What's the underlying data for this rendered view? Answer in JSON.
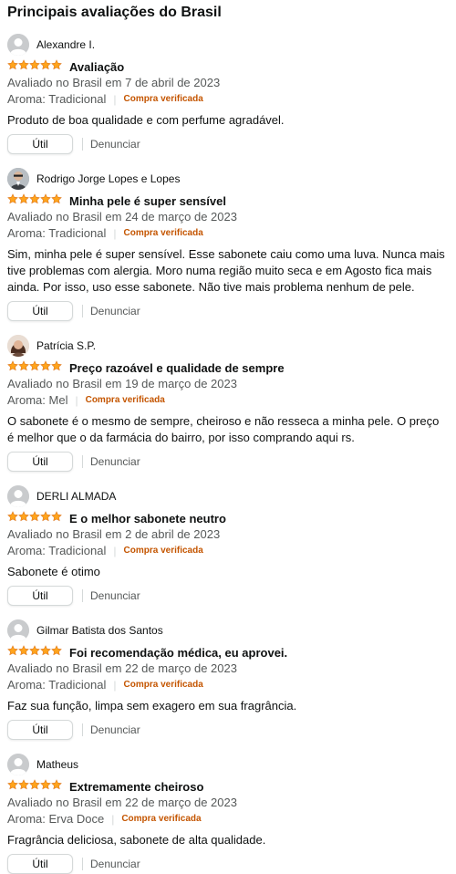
{
  "heading": "Principais avaliações do Brasil",
  "colors": {
    "star": "#ffa41c",
    "verified": "#c45500"
  },
  "reviews": [
    {
      "name": "Alexandre I.",
      "avatar": "default-avatar",
      "rating": 5,
      "title": "Avaliação",
      "date": "Avaliado no Brasil em 7 de abril de 2023",
      "variant": "Aroma: Tradicional",
      "verified": "Compra verificada",
      "body": "Produto de boa qualidade e com perfume agradável.",
      "helpful": "Útil",
      "report": "Denunciar"
    },
    {
      "name": "Rodrigo Jorge Lopes e Lopes",
      "avatar": "photo-man",
      "rating": 5,
      "title": "Minha pele é super sensível",
      "date": "Avaliado no Brasil em 24 de março de 2023",
      "variant": "Aroma: Tradicional",
      "verified": "Compra verificada",
      "body": "Sim, minha pele é super sensível. Esse sabonete caiu como uma luva. Nunca mais tive problemas com alergia. Moro numa região muito seca e em Agosto fica mais ainda. Por isso, uso esse sabonete. Não tive mais problema nenhum de pele.",
      "helpful": "Útil",
      "report": "Denunciar"
    },
    {
      "name": "Patrícia S.P.",
      "avatar": "photo-woman",
      "rating": 5,
      "title": "Preço razoável e qualidade de sempre",
      "date": "Avaliado no Brasil em 19 de março de 2023",
      "variant": "Aroma: Mel",
      "verified": "Compra verificada",
      "body": "O sabonete é o mesmo de sempre, cheiroso e não resseca a minha pele. O preço é melhor que o da farmácia do bairro, por isso comprando aqui rs.",
      "helpful": "Útil",
      "report": "Denunciar"
    },
    {
      "name": "DERLI ALMADA",
      "avatar": "default-avatar",
      "rating": 5,
      "title": "E o melhor sabonete neutro",
      "date": "Avaliado no Brasil em 2 de abril de 2023",
      "variant": "Aroma: Tradicional",
      "verified": "Compra verificada",
      "body": "Sabonete é otimo",
      "helpful": "Útil",
      "report": "Denunciar"
    },
    {
      "name": "Gilmar Batista dos Santos",
      "avatar": "default-avatar",
      "rating": 5,
      "title": "Foi recomendação médica, eu aprovei.",
      "date": "Avaliado no Brasil em 22 de março de 2023",
      "variant": "Aroma: Tradicional",
      "verified": "Compra verificada",
      "body": "Faz sua função, limpa sem exagero em sua fragrância.",
      "helpful": "Útil",
      "report": "Denunciar"
    },
    {
      "name": "Matheus",
      "avatar": "default-avatar",
      "rating": 5,
      "title": "Extremamente cheiroso",
      "date": "Avaliado no Brasil em 22 de março de 2023",
      "variant": "Aroma: Erva Doce",
      "verified": "Compra verificada",
      "body": "Fragrância deliciosa, sabonete de alta qualidade.",
      "helpful": "Útil",
      "report": "Denunciar"
    }
  ]
}
